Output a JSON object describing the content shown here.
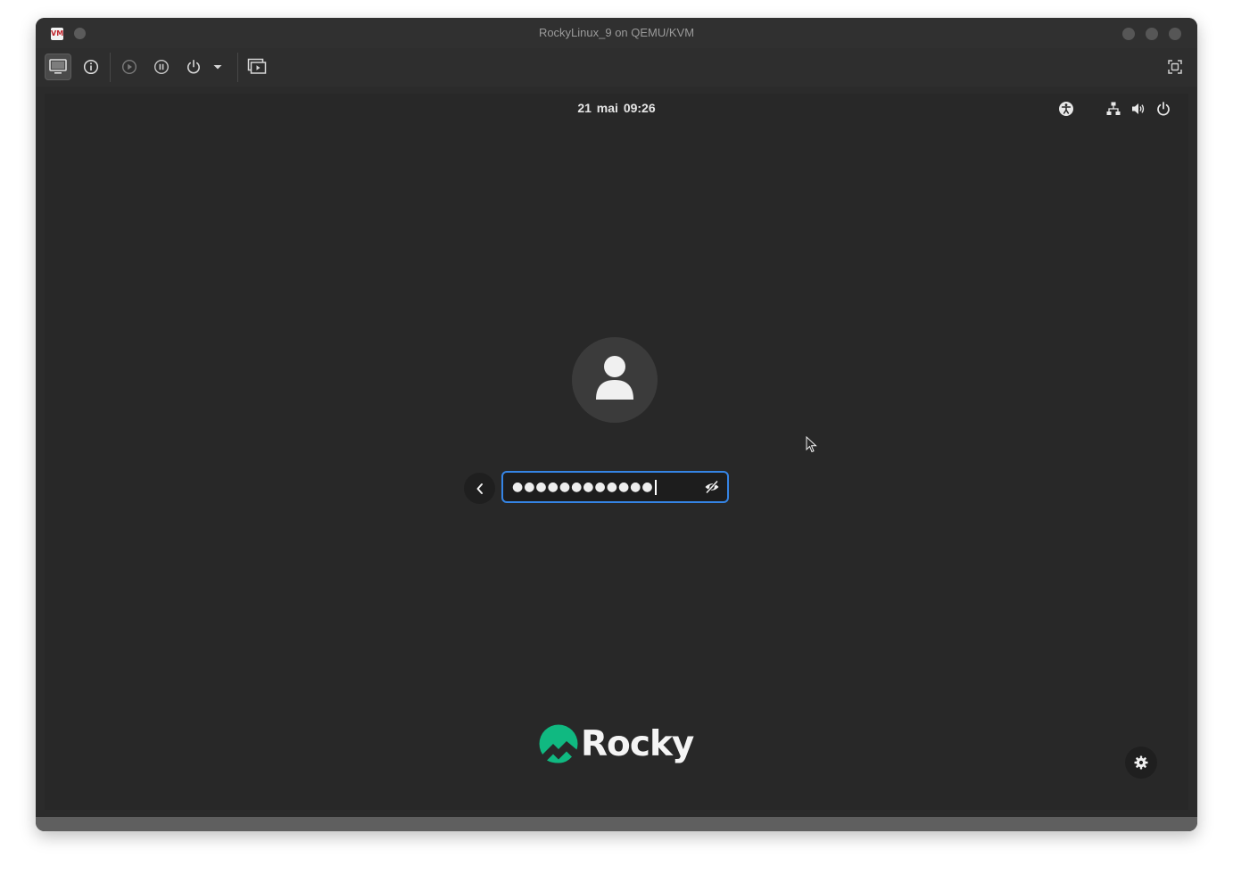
{
  "window": {
    "title": "RockyLinux_9 on QEMU/KVM",
    "app_icon": "virt-manager-icon"
  },
  "toolbar": {
    "buttons": [
      {
        "name": "console-view-button",
        "icon": "monitor-icon"
      },
      {
        "name": "details-view-button",
        "icon": "info-icon"
      },
      {
        "name": "run-button",
        "icon": "play-icon"
      },
      {
        "name": "pause-button",
        "icon": "pause-icon"
      },
      {
        "name": "shutdown-button",
        "icon": "power-icon"
      },
      {
        "name": "shutdown-menu-button",
        "icon": "caret-down-icon"
      },
      {
        "name": "snapshots-button",
        "icon": "snapshots-icon"
      },
      {
        "name": "fullscreen-button",
        "icon": "fullscreen-icon"
      }
    ]
  },
  "guest": {
    "topbar": {
      "clock": "21 mai  09:26",
      "icons": [
        "accessibility-icon",
        "network-icon",
        "volume-icon",
        "power-icon"
      ]
    },
    "login": {
      "password_value": "●●●●●●●●●●●●",
      "avatar_icon": "user-icon",
      "back_icon": "chevron-left-icon",
      "peek_icon": "eye-slash-icon"
    },
    "brand": {
      "logo_text": "Rocky",
      "logo_color": "#10b981"
    },
    "settings_icon": "gear-icon"
  },
  "colors": {
    "focus_accent": "#3584e4",
    "screen_bg": "#282828"
  }
}
